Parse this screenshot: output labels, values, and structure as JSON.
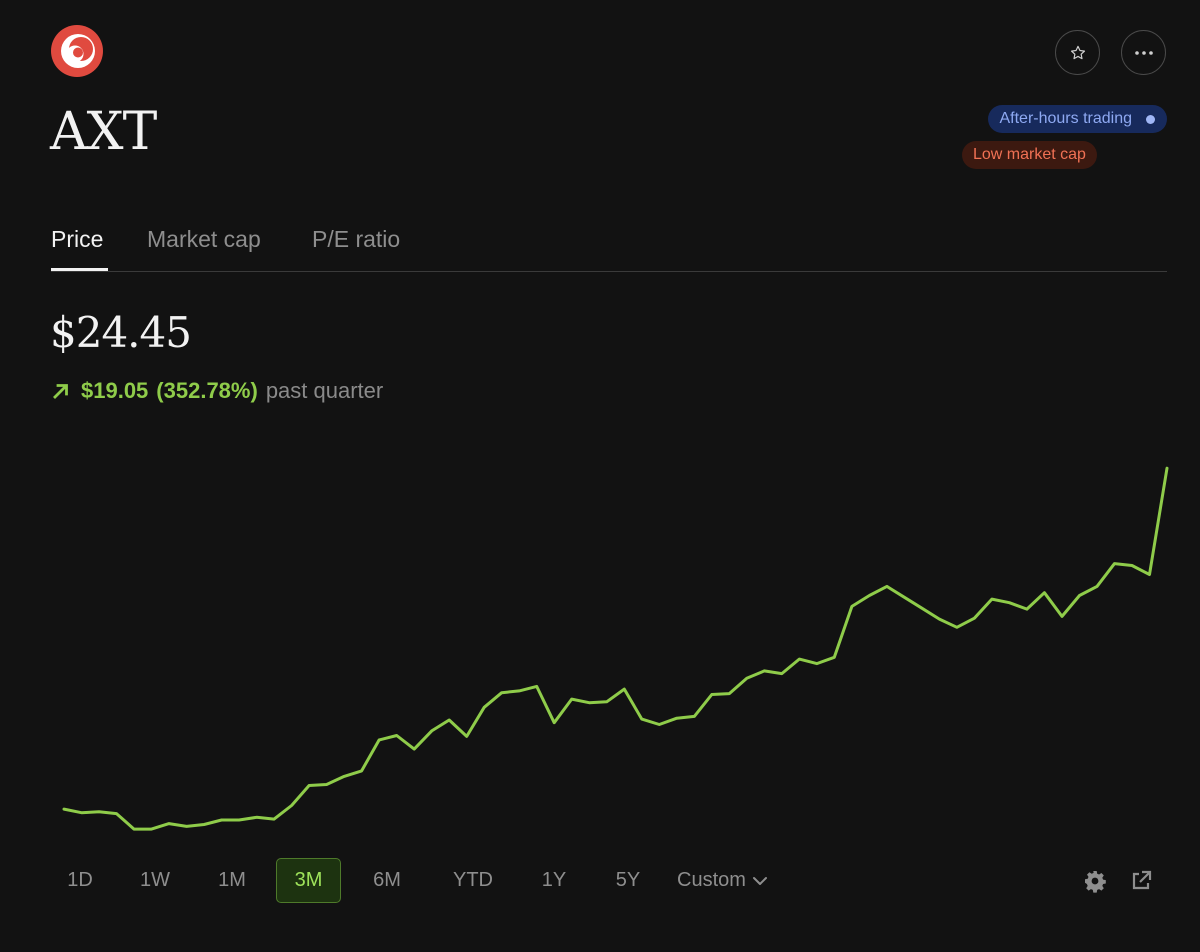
{
  "header": {
    "ticker": "AXT",
    "badges": {
      "after_hours": "After-hours trading",
      "low_market_cap": "Low market cap"
    }
  },
  "tabs": [
    "Price",
    "Market cap",
    "P/E ratio"
  ],
  "active_tab": "Price",
  "quote": {
    "price": "$24.45",
    "change": "$19.05",
    "change_percent": "(352.78%)",
    "period": "past quarter",
    "direction": "up"
  },
  "ranges": [
    "1D",
    "1W",
    "1M",
    "3M",
    "6M",
    "YTD",
    "1Y",
    "5Y",
    "Custom"
  ],
  "active_range": "3M",
  "colors": {
    "background": "#121212",
    "line": "#8fcc4a",
    "accent_positive": "#8fcc4a",
    "logo": "#e04a3f",
    "badge_blue_text": "#8ea9f2",
    "badge_red_text": "#f07154"
  },
  "icons": [
    "logo",
    "star-icon",
    "more-icon",
    "arrow-up-right-icon",
    "chevron-down-icon",
    "gear-icon",
    "external-link-icon"
  ],
  "chart_data": {
    "type": "line",
    "grid": false,
    "legend": "none",
    "ylim": [
      4,
      26
    ],
    "series": [
      {
        "values": [
          5.7,
          5.5,
          5.55,
          5.45,
          4.6,
          4.6,
          4.9,
          4.75,
          4.85,
          5.1,
          5.1,
          5.25,
          5.15,
          5.9,
          7.0,
          7.05,
          7.5,
          7.8,
          9.5,
          9.75,
          9.0,
          10.0,
          10.6,
          9.7,
          11.3,
          12.1,
          12.2,
          12.45,
          10.45,
          11.75,
          11.55,
          11.6,
          12.3,
          10.65,
          10.35,
          10.7,
          10.8,
          12.0,
          12.05,
          12.9,
          13.3,
          13.15,
          13.95,
          13.7,
          14.05,
          16.85,
          17.45,
          17.95,
          17.35,
          16.75,
          16.15,
          15.7,
          16.2,
          17.25,
          17.05,
          16.7,
          17.6,
          16.3,
          17.45,
          17.95,
          19.2,
          19.1,
          18.6,
          24.45
        ]
      }
    ]
  }
}
